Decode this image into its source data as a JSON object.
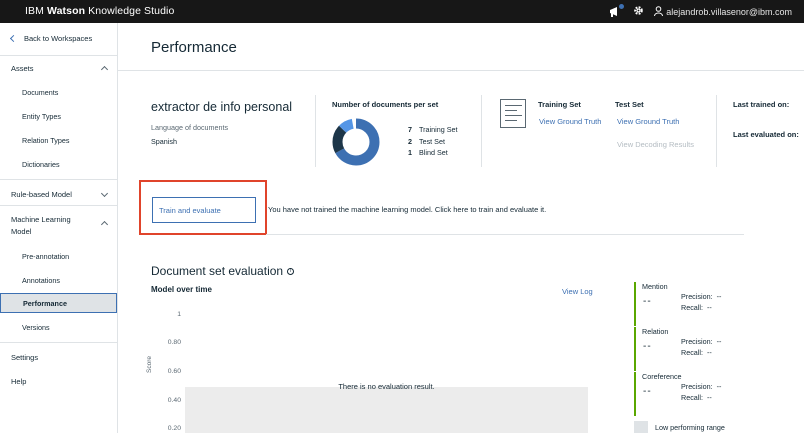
{
  "topbar": {
    "brand_ibm": "IBM",
    "brand_watson": "Watson",
    "brand_rest": "Knowledge Studio",
    "user_email": "alejandrob.villasenor@ibm.com",
    "icons": [
      "megaphone-icon",
      "gear-icon",
      "user-icon"
    ]
  },
  "sidebar": {
    "back_label": "Back to Workspaces",
    "assets_label": "Assets",
    "assets_items": [
      "Documents",
      "Entity Types",
      "Relation Types",
      "Dictionaries"
    ],
    "rule_based_label": "Rule-based Model",
    "ml_label_line1": "Machine Learning",
    "ml_label_line2": "Model",
    "ml_items": [
      "Pre-annotation",
      "Annotations",
      "Performance",
      "Versions"
    ],
    "settings_label": "Settings",
    "help_label": "Help",
    "active_item": "Performance"
  },
  "main": {
    "title": "Performance",
    "project_name": "extractor de info personal",
    "language_label": "Language of documents",
    "language_value": "Spanish",
    "docs_per_set_title": "Number of documents per set",
    "doc_sets": [
      {
        "count": "7",
        "label": "Training Set",
        "color": "#3d70b2"
      },
      {
        "count": "2",
        "label": "Test Set",
        "color": "#1d3649"
      },
      {
        "count": "1",
        "label": "Blind Set",
        "color": "#5596e6"
      }
    ],
    "training_set_label": "Training Set",
    "test_set_label": "Test Set",
    "view_ground_truth_1": "View Ground Truth",
    "view_ground_truth_2": "View Ground Truth",
    "view_decoding_results": "View Decoding Results",
    "last_trained_label": "Last trained on:",
    "last_evaluated_label": "Last evaluated on:",
    "train_button_label": "Train and evaluate",
    "train_message": "You have not trained the machine learning model. Click here to train and evaluate it.",
    "eval_title": "Document set evaluation",
    "info_icon": "i",
    "model_over_time_label": "Model over time",
    "view_log_label": "View Log",
    "y_axis_label": "Score",
    "y_ticks": [
      "1",
      "0.80",
      "0.60",
      "0.40",
      "0.20"
    ],
    "no_result_text": "There is no evaluation result.",
    "metrics": [
      {
        "name": "Mention",
        "value": "--",
        "precision_label": "Precision:",
        "precision_value": "--",
        "recall_label": "Recall:",
        "recall_value": "--"
      },
      {
        "name": "Relation",
        "value": "--",
        "precision_label": "Precision:",
        "precision_value": "--",
        "recall_label": "Recall:",
        "recall_value": "--"
      },
      {
        "name": "Coreference",
        "value": "--",
        "precision_label": "Precision:",
        "precision_value": "--",
        "recall_label": "Recall:",
        "recall_value": "--"
      }
    ],
    "low_range_label": "Low performing range",
    "accent_color": "#3d70b2",
    "highlight_color": "#e0442b",
    "metric_bar_color": "#5aa700"
  }
}
